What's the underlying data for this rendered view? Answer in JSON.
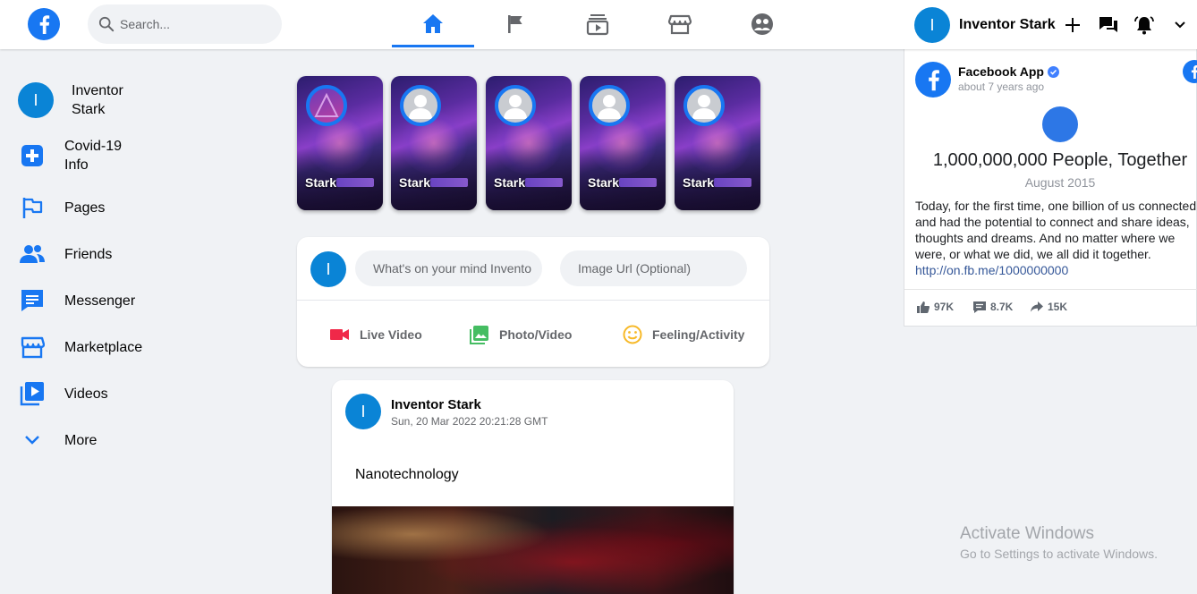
{
  "header": {
    "search_placeholder": "Search...",
    "user_initial": "I",
    "user_name": "Inventor Stark",
    "active_tab": "home"
  },
  "sidebar": {
    "profile": {
      "initial": "I",
      "name_line1": "Inventor",
      "name_line2": "Stark"
    },
    "items": [
      {
        "label_line1": "Covid-19",
        "label_line2": "Info",
        "icon": "plus-square-icon"
      },
      {
        "label": "Pages",
        "icon": "flag-icon"
      },
      {
        "label": "Friends",
        "icon": "friends-icon"
      },
      {
        "label": "Messenger",
        "icon": "messenger-icon"
      },
      {
        "label": "Marketplace",
        "icon": "store-icon"
      },
      {
        "label": "Videos",
        "icon": "video-icon"
      },
      {
        "label": "More",
        "icon": "chevron-down-icon"
      }
    ]
  },
  "stories": [
    {
      "name": "Stark"
    },
    {
      "name": "Stark"
    },
    {
      "name": "Stark"
    },
    {
      "name": "Stark"
    },
    {
      "name": "Stark"
    }
  ],
  "create_post": {
    "initial": "I",
    "text_placeholder": "What's on your mind Invento",
    "image_placeholder": "Image Url (Optional)",
    "actions": {
      "live": "Live Video",
      "photo": "Photo/Video",
      "feeling": "Feeling/Activity"
    }
  },
  "post": {
    "initial": "I",
    "author": "Inventor Stark",
    "timestamp": "Sun, 20 Mar 2022 20:21:28 GMT",
    "text": "Nanotechnology"
  },
  "right_panel": {
    "page_name": "Facebook App",
    "time_ago": "about 7 years ago",
    "headline": "1,000,000,000 People, Together",
    "date": "August 2015",
    "body": "Today, for the first time, one billion of us connected and had the potential to connect and share ideas, thoughts and dreams. And no matter where we were, or what we did, we all did it together.",
    "link": "http://on.fb.me/1000000000",
    "likes": "97K",
    "comments": "8.7K",
    "shares": "15K"
  },
  "watermark": {
    "title": "Activate Windows",
    "subtitle": "Go to Settings to activate Windows."
  },
  "colors": {
    "brand": "#1877f2",
    "avatar": "#0a84d6",
    "background": "#f0f2f5"
  }
}
